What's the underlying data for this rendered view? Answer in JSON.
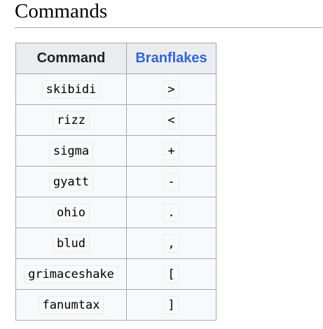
{
  "heading": "Commands",
  "table": {
    "headers": {
      "command": "Command",
      "branflakes": "Branflakes"
    },
    "rows": [
      {
        "command": "skibidi",
        "branflakes": ">"
      },
      {
        "command": "rizz",
        "branflakes": "<"
      },
      {
        "command": "sigma",
        "branflakes": "+"
      },
      {
        "command": "gyatt",
        "branflakes": "-"
      },
      {
        "command": "ohio",
        "branflakes": "."
      },
      {
        "command": "blud",
        "branflakes": ","
      },
      {
        "command": "grimaceshake",
        "branflakes": "["
      },
      {
        "command": "fanumtax",
        "branflakes": "]"
      }
    ]
  },
  "colors": {
    "link": "#3366cc",
    "header_bg": "#eaecf0",
    "cell_bg": "#f8f9fa",
    "border": "#a2a9b1"
  }
}
